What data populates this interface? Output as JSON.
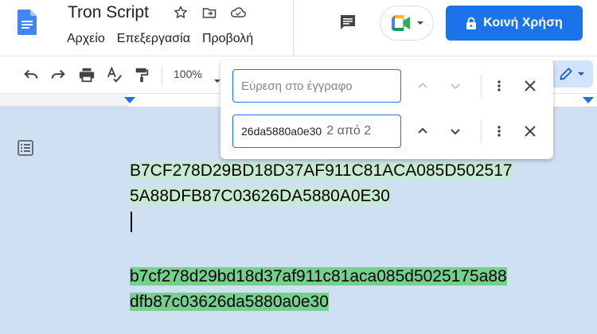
{
  "app": {
    "title": "Tron Script",
    "menu": [
      "Αρχείο",
      "Επεξεργασία",
      "Προβολή"
    ]
  },
  "header": {
    "share_label": "Κοινή Χρήση"
  },
  "toolbar": {
    "zoom": "100%"
  },
  "find": {
    "placeholder": "Εύρεση στο έγγραφο",
    "query": "26da5880a0e30",
    "count": "2 από 2"
  },
  "document": {
    "line1": "B7CF278D29BD18D37AF911C81ACA085D502517",
    "line2": "5A88DFB87C03626DA5880A0E30",
    "line3": "b7cf278d29bd18d37af911c81aca085d5025175a88",
    "line4": "dfb87c03626da5880a0e30"
  },
  "colors": {
    "accent": "#1a73e8",
    "highlight_light": "#c6ebd2",
    "highlight_current": "#75d08e",
    "page_background": "#cfe0f2"
  }
}
